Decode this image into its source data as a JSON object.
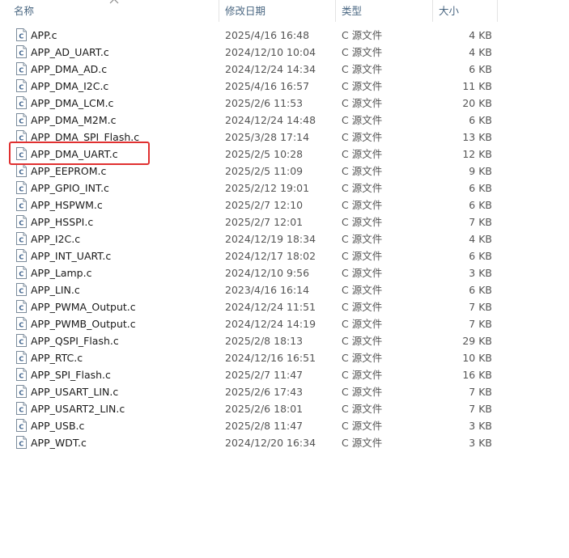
{
  "header": {
    "name": "名称",
    "date": "修改日期",
    "type": "类型",
    "size": "大小"
  },
  "sort": {
    "column": "name",
    "direction": "ascending",
    "icon": "chevron-up-icon"
  },
  "file_icon": "c-source-file-icon",
  "highlight": {
    "file": "APP_DMA_UART.c",
    "color": "#e03030"
  },
  "files": [
    {
      "name": "APP.c",
      "date": "2025/4/16 16:48",
      "type": "C 源文件",
      "size": "4 KB"
    },
    {
      "name": "APP_AD_UART.c",
      "date": "2024/12/10 10:04",
      "type": "C 源文件",
      "size": "4 KB"
    },
    {
      "name": "APP_DMA_AD.c",
      "date": "2024/12/24 14:34",
      "type": "C 源文件",
      "size": "6 KB"
    },
    {
      "name": "APP_DMA_I2C.c",
      "date": "2025/4/16 16:57",
      "type": "C 源文件",
      "size": "11 KB"
    },
    {
      "name": "APP_DMA_LCM.c",
      "date": "2025/2/6 11:53",
      "type": "C 源文件",
      "size": "20 KB"
    },
    {
      "name": "APP_DMA_M2M.c",
      "date": "2024/12/24 14:48",
      "type": "C 源文件",
      "size": "6 KB"
    },
    {
      "name": "APP_DMA_SPI_Flash.c",
      "date": "2025/3/28 17:14",
      "type": "C 源文件",
      "size": "13 KB"
    },
    {
      "name": "APP_DMA_UART.c",
      "date": "2025/2/5 10:28",
      "type": "C 源文件",
      "size": "12 KB"
    },
    {
      "name": "APP_EEPROM.c",
      "date": "2025/2/5 11:09",
      "type": "C 源文件",
      "size": "9 KB"
    },
    {
      "name": "APP_GPIO_INT.c",
      "date": "2025/2/12 19:01",
      "type": "C 源文件",
      "size": "6 KB"
    },
    {
      "name": "APP_HSPWM.c",
      "date": "2025/2/7 12:10",
      "type": "C 源文件",
      "size": "6 KB"
    },
    {
      "name": "APP_HSSPI.c",
      "date": "2025/2/7 12:01",
      "type": "C 源文件",
      "size": "7 KB"
    },
    {
      "name": "APP_I2C.c",
      "date": "2024/12/19 18:34",
      "type": "C 源文件",
      "size": "4 KB"
    },
    {
      "name": "APP_INT_UART.c",
      "date": "2024/12/17 18:02",
      "type": "C 源文件",
      "size": "6 KB"
    },
    {
      "name": "APP_Lamp.c",
      "date": "2024/12/10 9:56",
      "type": "C 源文件",
      "size": "3 KB"
    },
    {
      "name": "APP_LIN.c",
      "date": "2023/4/16 16:14",
      "type": "C 源文件",
      "size": "6 KB"
    },
    {
      "name": "APP_PWMA_Output.c",
      "date": "2024/12/24 11:51",
      "type": "C 源文件",
      "size": "7 KB"
    },
    {
      "name": "APP_PWMB_Output.c",
      "date": "2024/12/24 14:19",
      "type": "C 源文件",
      "size": "7 KB"
    },
    {
      "name": "APP_QSPI_Flash.c",
      "date": "2025/2/8 18:13",
      "type": "C 源文件",
      "size": "29 KB"
    },
    {
      "name": "APP_RTC.c",
      "date": "2024/12/16 16:51",
      "type": "C 源文件",
      "size": "10 KB"
    },
    {
      "name": "APP_SPI_Flash.c",
      "date": "2025/2/7 11:47",
      "type": "C 源文件",
      "size": "16 KB"
    },
    {
      "name": "APP_USART_LIN.c",
      "date": "2025/2/6 17:43",
      "type": "C 源文件",
      "size": "7 KB"
    },
    {
      "name": "APP_USART2_LIN.c",
      "date": "2025/2/6 18:01",
      "type": "C 源文件",
      "size": "7 KB"
    },
    {
      "name": "APP_USB.c",
      "date": "2025/2/8 11:47",
      "type": "C 源文件",
      "size": "3 KB"
    },
    {
      "name": "APP_WDT.c",
      "date": "2024/12/20 16:34",
      "type": "C 源文件",
      "size": "3 KB"
    }
  ]
}
